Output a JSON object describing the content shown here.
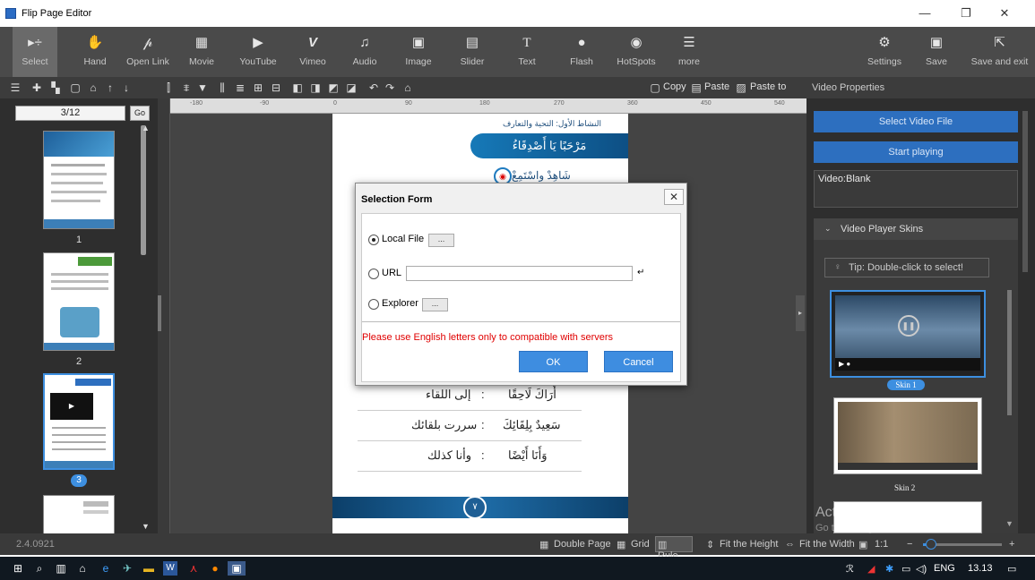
{
  "window": {
    "title": "Flip Page Editor",
    "minimize": "—",
    "restore": "❐",
    "close": "✕"
  },
  "toolbar": [
    {
      "label": "Select",
      "icon": "cursor-icon",
      "glyph": "▸÷",
      "selected": true
    },
    {
      "label": "Hand",
      "icon": "hand-icon",
      "glyph": "✋"
    },
    {
      "label": "Open Link",
      "icon": "link-icon",
      "glyph": "🔗"
    },
    {
      "label": "Movie",
      "icon": "film-icon",
      "glyph": "▦"
    },
    {
      "label": "YouTube",
      "icon": "youtube-icon",
      "glyph": "▶"
    },
    {
      "label": "Vimeo",
      "icon": "vimeo-icon",
      "glyph": "V"
    },
    {
      "label": "Audio",
      "icon": "music-icon",
      "glyph": "♫"
    },
    {
      "label": "Image",
      "icon": "image-icon",
      "glyph": "▣"
    },
    {
      "label": "Slider",
      "icon": "slider-icon",
      "glyph": "▤"
    },
    {
      "label": "Text",
      "icon": "text-icon",
      "glyph": "T"
    },
    {
      "label": "Flash",
      "icon": "flash-icon",
      "glyph": "●"
    },
    {
      "label": "HotSpots",
      "icon": "hotspot-icon",
      "glyph": "◉"
    },
    {
      "label": "more",
      "icon": "more-icon",
      "glyph": "☰"
    }
  ],
  "toolbar_right": [
    {
      "label": "Settings",
      "icon": "gear-icon",
      "glyph": "⚙"
    },
    {
      "label": "Save",
      "icon": "save-icon",
      "glyph": "▣"
    },
    {
      "label": "Save and exit",
      "icon": "save-exit-icon",
      "glyph": "⇱"
    }
  ],
  "edit_toolbar": {
    "copy": "Copy",
    "paste": "Paste",
    "paste_to": "Paste to"
  },
  "left_panel": {
    "page_input": "3/12",
    "go": "Go",
    "thumbs": [
      "1",
      "2",
      "3"
    ]
  },
  "canvas": {
    "ruler_marks": [
      "-180",
      "-90",
      "0",
      "90",
      "180",
      "270",
      "360",
      "450",
      "540"
    ],
    "arabic_header_small": "النشاط الأول: التحية والتعارف",
    "arabic_banner": "مَرْحَبًا يَا أَصْدِقَاءُ",
    "arabic_listen": "شَاهِدْ واسْتَمِعْ",
    "arabic_lines": [
      {
        "left": "إلى اللقاء",
        "right": "أَرَاكَ لَاحِقًا"
      },
      {
        "left": "سررت بلقائك",
        "right": "سَعِيدٌ بِلِقَائِكَ"
      },
      {
        "left": "وأنا كذلك",
        "right": "وَأَنَا أَيْضًا"
      }
    ],
    "page_badge": "٧"
  },
  "right_panel": {
    "header": "Video Properties",
    "select_video": "Select Video File",
    "start_playing": "Start playing",
    "video_info": "Video:Blank",
    "skins_header": "Video Player Skins",
    "tip": "Tip: Double-click to select!",
    "skins": [
      "Skin 1",
      "Skin 2"
    ]
  },
  "status": {
    "version": "2.4.0921",
    "double_page": "Double Page",
    "grid": "Grid",
    "rule": "Rule",
    "fit_height": "Fit the Height",
    "fit_width": "Fit the Width",
    "ratio": "1:1",
    "zoom_level": 0.1
  },
  "watermark": {
    "line1": "Activate Windows",
    "line2": "Go to Settings to activate Windows."
  },
  "taskbar": {
    "lang": "ENG",
    "time": "13.13"
  },
  "dialog": {
    "title": "Selection Form",
    "close": "✕",
    "options": [
      {
        "label": "Local File",
        "selected": true,
        "button": "..."
      },
      {
        "label": "URL",
        "selected": false
      },
      {
        "label": "Explorer",
        "selected": false,
        "button": "..."
      }
    ],
    "url_value": "",
    "enter_glyph": "↵",
    "warning": "Please use English letters only to compatible with servers",
    "ok": "OK",
    "cancel": "Cancel"
  },
  "colors": {
    "toolbar": "#4a4a4a",
    "panel": "#2e2e2e",
    "accent_blue": "#2d6fbf",
    "warning": "#e00000"
  }
}
